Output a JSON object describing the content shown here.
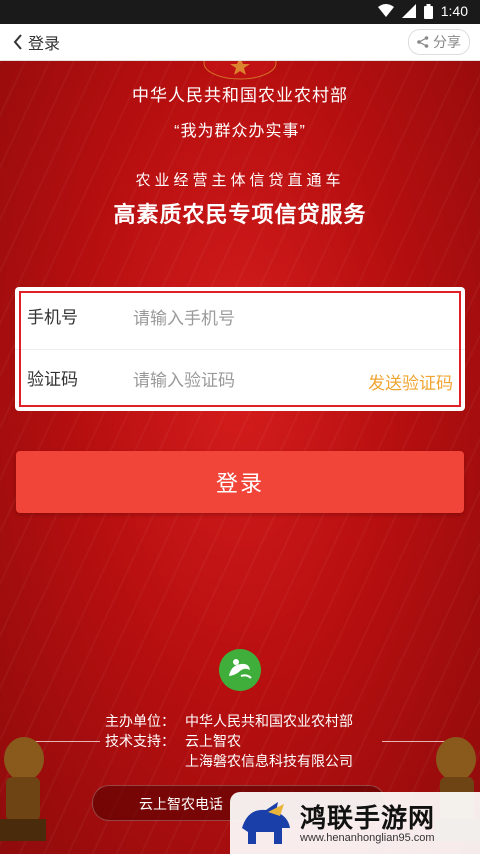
{
  "status_bar": {
    "time": "1:40"
  },
  "nav": {
    "back_label": "登录",
    "share_label": "分享"
  },
  "banner": {
    "org": "中华人民共和国农业农村部",
    "slogan": "“我为群众办实事”",
    "subtitle": "农业经营主体信贷直通车",
    "headline": "高素质农民专项信贷服务"
  },
  "form": {
    "phone_label": "手机号",
    "phone_placeholder": "请输入手机号",
    "phone_value": "",
    "code_label": "验证码",
    "code_placeholder": "请输入验证码",
    "code_value": "",
    "send_code": "发送验证码"
  },
  "login_button": "登录",
  "footer": {
    "sponsor_key": "主办单位：",
    "sponsor_value": "中华人民共和国农业农村部",
    "tech_key": "技术支持：",
    "tech_value1": "云上智农",
    "tech_value2": "上海磐农信息科技有限公司",
    "hotline": "云上智农电话"
  },
  "watermark": {
    "title": "鸿联手游网",
    "url": "www.henanhonglian95.com"
  },
  "colors": {
    "primary_red": "#b30d0d",
    "button_red": "#f2453a",
    "send_code": "#f0a532",
    "logo_green": "#3fae3a"
  },
  "icons": [
    "wifi-icon",
    "signal-icon",
    "battery-icon",
    "back-chevron-icon",
    "share-icon",
    "app-logo-icon"
  ]
}
